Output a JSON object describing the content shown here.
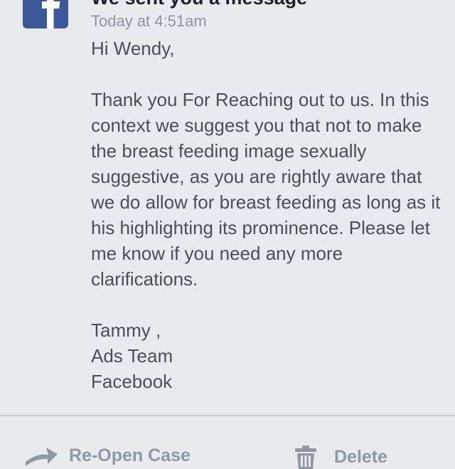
{
  "header": {
    "title": "We sent you a message",
    "timestamp": "Today at 4:51am"
  },
  "message": {
    "greeting": "Hi Wendy,",
    "body": "Thank you For Reaching out to us. In this context we suggest you that not to make the breast feeding image sexually suggestive, as you are rightly aware that we do allow for breast feeding as long as it his highlighting its prominence. Please let me know if you need any more clarifications.",
    "signature_name": "Tammy ,",
    "signature_team": "Ads Team",
    "signature_company": "Facebook"
  },
  "actions": {
    "reopen_label": "Re-Open Case",
    "reopen_icon": "reply-arrow-icon",
    "delete_label": "Delete",
    "delete_icon": "trash-icon"
  },
  "colors": {
    "background": "#e9eaee",
    "brand": "#3b5998",
    "text": "#4b4f56",
    "muted": "#90949c",
    "action": "#9197a3"
  }
}
